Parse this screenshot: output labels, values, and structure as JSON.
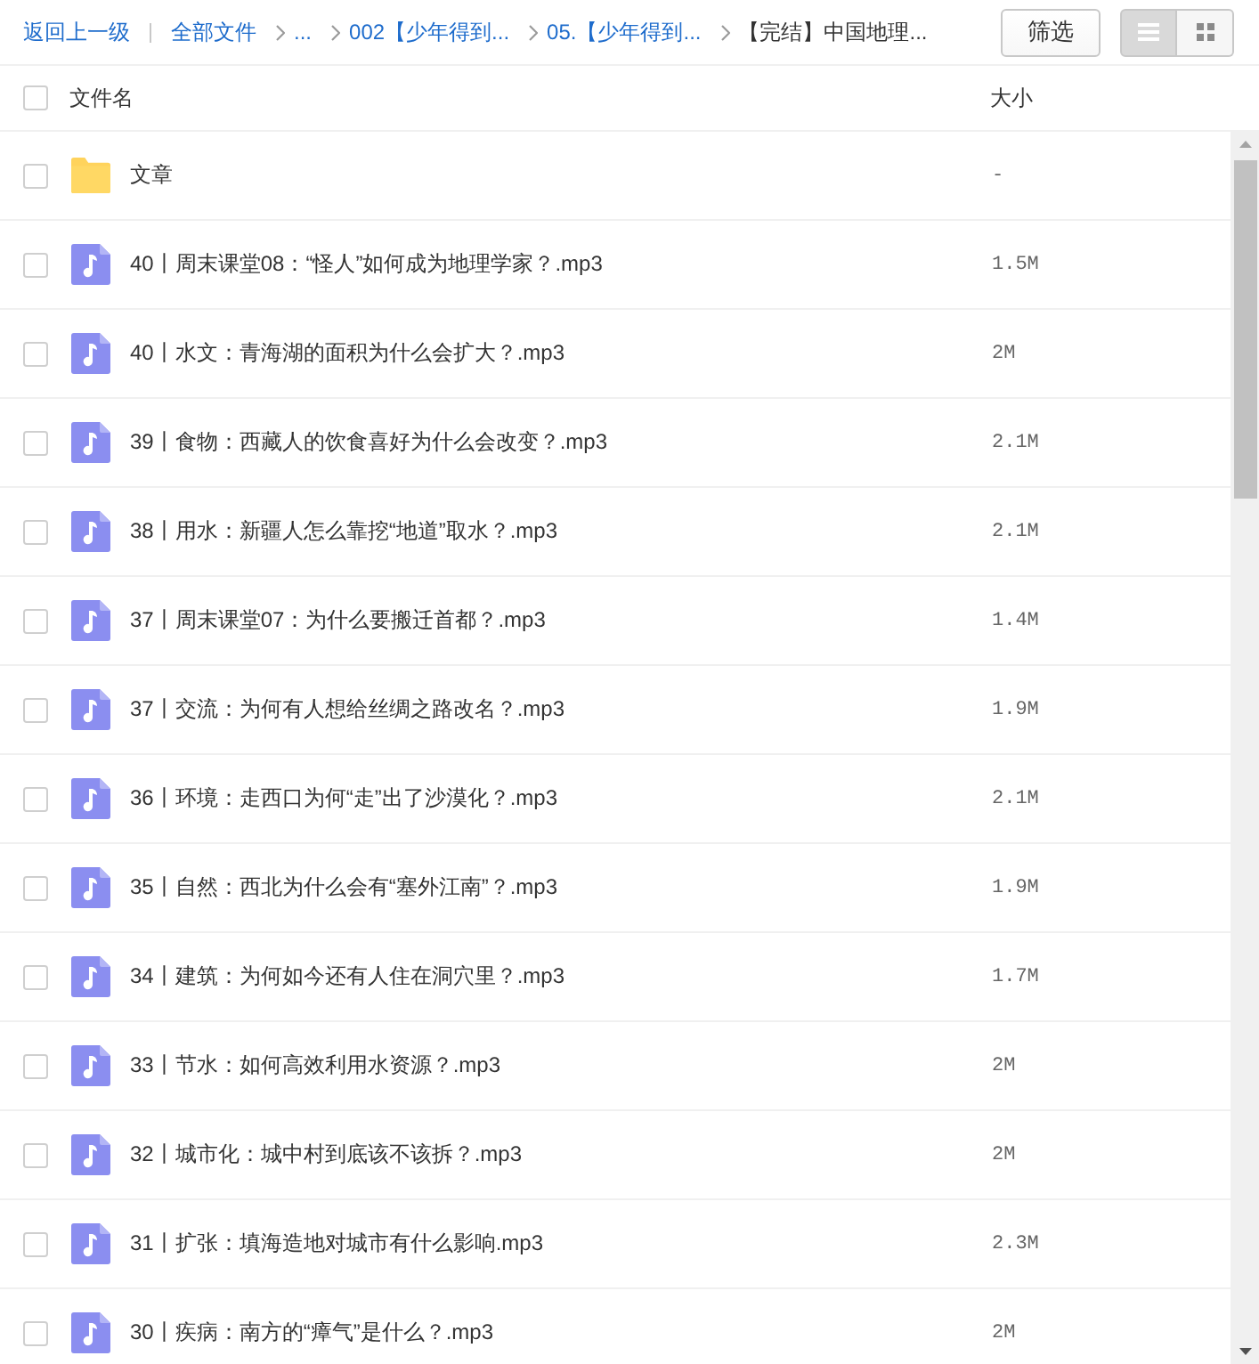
{
  "toolbar": {
    "back_link": "返回上一级",
    "all_files_link": "全部文件",
    "breadcrumb": [
      {
        "label": "...",
        "current": false
      },
      {
        "label": "002【少年得到...",
        "current": false
      },
      {
        "label": "05.【少年得到...",
        "current": false
      },
      {
        "label": "【完结】中国地理...",
        "current": true
      }
    ],
    "filter_button": "筛选",
    "view_modes": [
      {
        "kind": "list",
        "selected": true
      },
      {
        "kind": "grid",
        "selected": false
      }
    ]
  },
  "table": {
    "columns": [
      "文件名",
      "大小"
    ],
    "select_all_checked": false,
    "rows": [
      {
        "kind": "folder",
        "name": "文章",
        "size": "-",
        "checked": false
      },
      {
        "kind": "audio",
        "name": "40丨周末课堂08：“怪人”如何成为地理学家？.mp3",
        "size": "1.5M",
        "checked": false
      },
      {
        "kind": "audio",
        "name": "40丨水文：青海湖的面积为什么会扩大？.mp3",
        "size": "2M",
        "checked": false
      },
      {
        "kind": "audio",
        "name": "39丨食物：西藏人的饮食喜好为什么会改变？.mp3",
        "size": "2.1M",
        "checked": false
      },
      {
        "kind": "audio",
        "name": "38丨用水：新疆人怎么靠挖“地道”取水？.mp3",
        "size": "2.1M",
        "checked": false
      },
      {
        "kind": "audio",
        "name": "37丨周末课堂07：为什么要搬迁首都？.mp3",
        "size": "1.4M",
        "checked": false
      },
      {
        "kind": "audio",
        "name": "37丨交流：为何有人想给丝绸之路改名？.mp3",
        "size": "1.9M",
        "checked": false
      },
      {
        "kind": "audio",
        "name": "36丨环境：走西口为何“走”出了沙漠化？.mp3",
        "size": "2.1M",
        "checked": false
      },
      {
        "kind": "audio",
        "name": "35丨自然：西北为什么会有“塞外江南”？.mp3",
        "size": "1.9M",
        "checked": false
      },
      {
        "kind": "audio",
        "name": "34丨建筑：为何如今还有人住在洞穴里？.mp3",
        "size": "1.7M",
        "checked": false
      },
      {
        "kind": "audio",
        "name": "33丨节水：如何高效利用水资源？.mp3",
        "size": "2M",
        "checked": false
      },
      {
        "kind": "audio",
        "name": "32丨城市化：城中村到底该不该拆？.mp3",
        "size": "2M",
        "checked": false
      },
      {
        "kind": "audio",
        "name": "31丨扩张：填海造地对城市有什么影响.mp3",
        "size": "2.3M",
        "checked": false
      },
      {
        "kind": "audio",
        "name": "30丨疾病：南方的“瘴气”是什么？.mp3",
        "size": "2M",
        "checked": false
      }
    ]
  }
}
